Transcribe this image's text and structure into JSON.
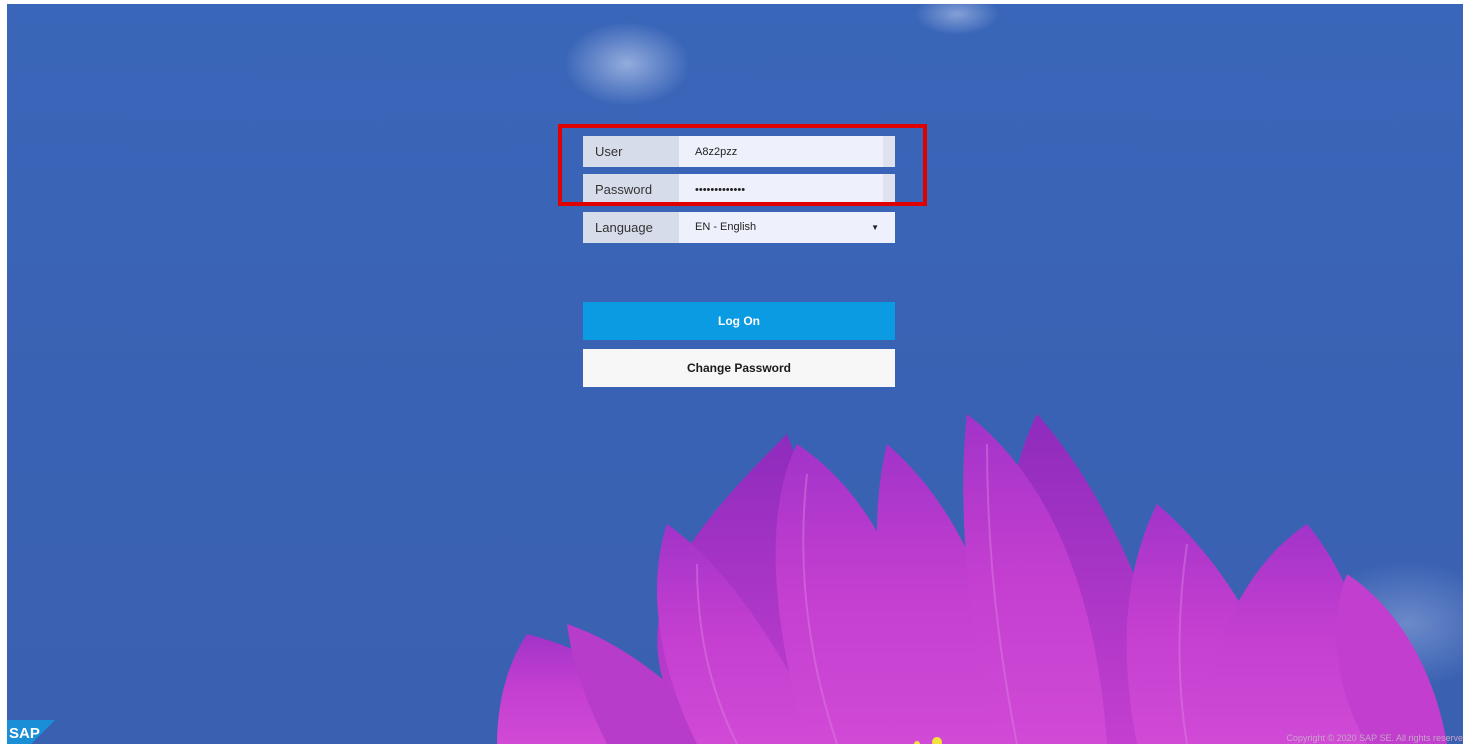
{
  "login_form": {
    "user": {
      "label": "User",
      "value": "A8z2pzz"
    },
    "password": {
      "label": "Password",
      "value": "•••••••••••••"
    },
    "language": {
      "label": "Language",
      "value": "EN - English",
      "arrow": "▼"
    }
  },
  "buttons": {
    "logon_label": "Log On",
    "change_password_label": "Change Password"
  },
  "branding": {
    "logo_text": "SAP",
    "copyright": "Copyright © 2020 SAP SE. All rights reserve"
  },
  "colors": {
    "background": "#3a63b5",
    "logon_button": "#0a9be2",
    "highlight": "#e00000",
    "flower": "#c236c8"
  },
  "icons": [
    "dropdown-arrow-icon",
    "sap-logo",
    "flower-background-image"
  ]
}
